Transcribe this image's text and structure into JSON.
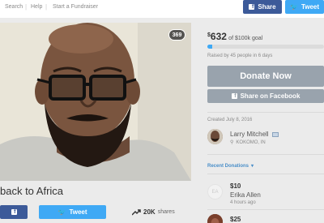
{
  "nav": {
    "links": [
      "Search",
      "Help",
      "Start a Fundraiser"
    ],
    "separator": "|"
  },
  "top_share": {
    "facebook": "Share",
    "twitter": "Tweet"
  },
  "campaign": {
    "heart_count": "369",
    "title": "back to Africa"
  },
  "bottom_share": {
    "twitter": "Tweet",
    "shares_count": "20K",
    "shares_label": "shares",
    "shares_icon": "trending-up-icon"
  },
  "sidebar": {
    "currency": "$",
    "raised_amount": "632",
    "goal_text": "of $100k goal",
    "progress_fraction": 0.00632,
    "raised_by": "Raised by 45 people in 6 days",
    "donate_label": "Donate Now",
    "facebook_share_label": "Share on Facebook",
    "created": "Created July 8, 2016",
    "organizer": {
      "name": "Larry Mitchell",
      "location": "KOKOMO, IN"
    },
    "recent_donations_label": "Recent Donations",
    "donations": [
      {
        "initials": "EA",
        "amount": "$10",
        "name": "Erika Allen",
        "time": "4 hours ago"
      },
      {
        "amount": "$25"
      }
    ]
  },
  "colors": {
    "facebook": "#3c5a99",
    "twitter": "#3fa9f5",
    "disabled_button": "#99a3ad",
    "link": "#4a8fc9"
  }
}
